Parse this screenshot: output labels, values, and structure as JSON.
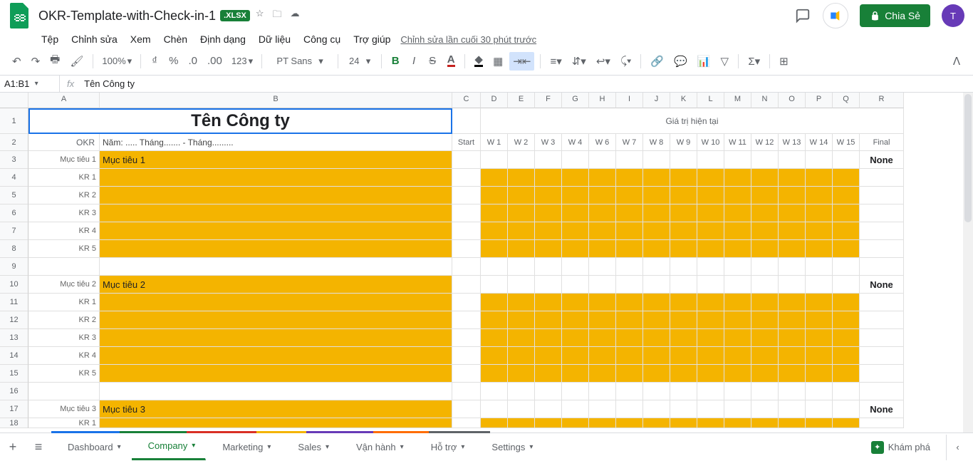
{
  "doc": {
    "title": "OKR-Template-with-Check-in-1",
    "badge": ".XLSX"
  },
  "menus": {
    "file": "Tệp",
    "edit": "Chỉnh sửa",
    "view": "Xem",
    "insert": "Chèn",
    "format": "Định dạng",
    "data": "Dữ liệu",
    "tools": "Công cụ",
    "help": "Trợ giúp",
    "lastEdit": "Chỉnh sửa lần cuối 30 phút trước"
  },
  "toolbar": {
    "zoom": "100%",
    "font": "PT Sans",
    "size": "24",
    "numfmt": "123",
    "currency": "₫",
    "pct": "%",
    "decDec": ".0",
    "incDec": ".00"
  },
  "share": {
    "label": "Chia Sẻ"
  },
  "avatar": {
    "initial": "T"
  },
  "nameBox": {
    "ref": "A1:B1",
    "fx": "fx",
    "val": "Tên Công ty"
  },
  "headers": {
    "cols": [
      "A",
      "B",
      "C",
      "D",
      "E",
      "F",
      "G",
      "H",
      "I",
      "J",
      "K",
      "L",
      "M",
      "N",
      "O",
      "P",
      "Q",
      "R"
    ]
  },
  "content": {
    "title": "Tên Công ty",
    "okr": "OKR",
    "period": "Năm: .....  Tháng.......    -    Tháng.........",
    "giaTri": "Giá trị hiện tại",
    "start": "Start",
    "weeks": [
      "W 1",
      "W 2",
      "W 3",
      "W 4",
      "W 6",
      "W 7",
      "W 8",
      "W 9",
      "W 10",
      "W 11",
      "W 12",
      "W 13",
      "W 14",
      "W 15"
    ],
    "final": "Final",
    "none": "None",
    "muctieu1_lbl": "Mục tiêu 1",
    "muctieu1": "Mục tiêu 1",
    "muctieu2_lbl": "Mục tiêu 2",
    "muctieu2": "Mục tiêu 2",
    "muctieu3_lbl": "Mục tiêu 3",
    "muctieu3": "Mục tiêu 3",
    "kr": [
      "KR 1",
      "KR 2",
      "KR 3",
      "KR 4",
      "KR 5"
    ]
  },
  "tabs": {
    "dashboard": "Dashboard",
    "company": "Company",
    "marketing": "Marketing",
    "sales": "Sales",
    "vanhanh": "Vận hành",
    "hotro": "Hỗ trợ",
    "settings": "Settings"
  },
  "explore": {
    "label": "Khám phá"
  }
}
